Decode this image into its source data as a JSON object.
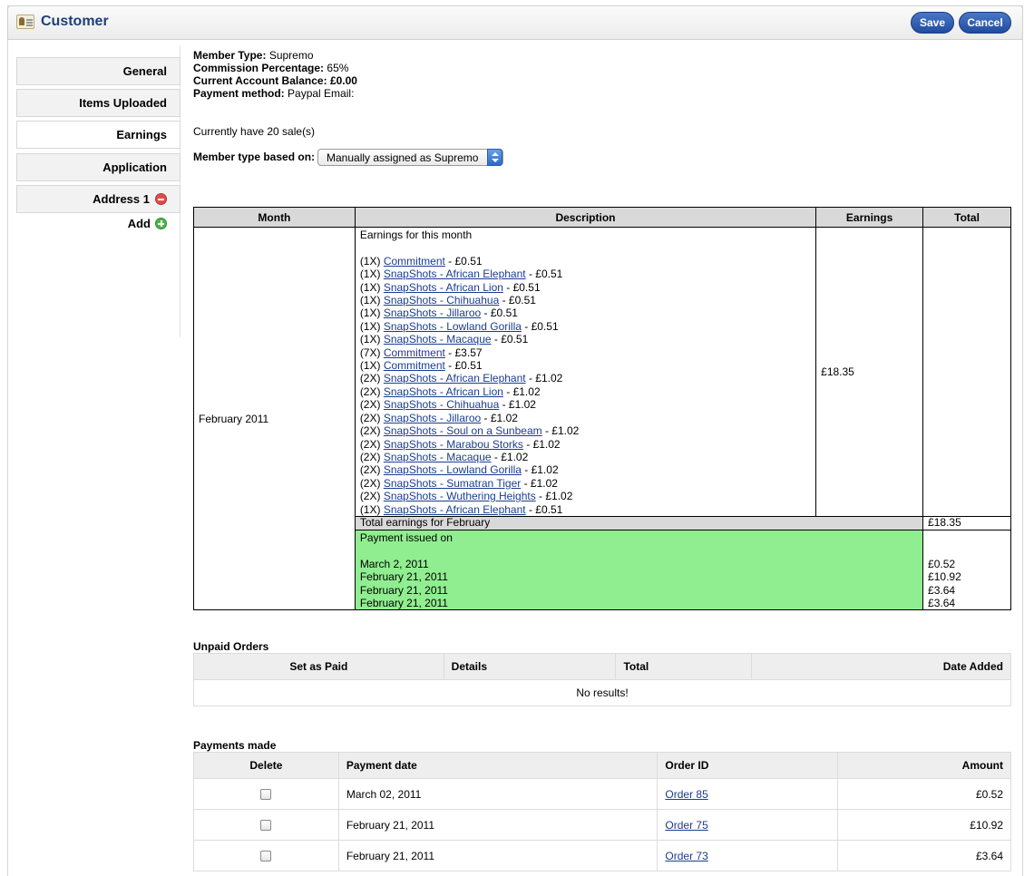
{
  "header": {
    "title": "Customer",
    "save_label": "Save",
    "cancel_label": "Cancel"
  },
  "sidebar": {
    "tabs": [
      {
        "label": "General"
      },
      {
        "label": "Items Uploaded"
      },
      {
        "label": "Earnings"
      },
      {
        "label": "Application"
      },
      {
        "label": "Address 1"
      }
    ],
    "add_label": "Add"
  },
  "info": {
    "member_type_label": "Member Type:",
    "member_type": "Supremo",
    "commission_label": "Commission Percentage:",
    "commission": "65%",
    "balance_label": "Current Account Balance:",
    "balance": "£0.00",
    "payment_method_label": "Payment method:",
    "payment_method": "Paypal Email:",
    "sales_text": "Currently have 20 sale(s)",
    "member_type_based_label": "Member type based on:",
    "member_type_based_value": "Manually assigned as Supremo"
  },
  "earnings": {
    "headers": [
      "Month",
      "Description",
      "Earnings",
      "Total"
    ],
    "month": "February 2011",
    "intro": "Earnings for this month",
    "items": [
      {
        "qty": "(1X)",
        "name": "Commitment",
        "amount": " - £0.51"
      },
      {
        "qty": "(1X)",
        "name": "SnapShots - African Elephant",
        "amount": " - £0.51"
      },
      {
        "qty": "(1X)",
        "name": "SnapShots - African Lion",
        "amount": " - £0.51"
      },
      {
        "qty": "(1X)",
        "name": "SnapShots - Chihuahua",
        "amount": " - £0.51"
      },
      {
        "qty": "(1X)",
        "name": "SnapShots - Jillaroo",
        "amount": " - £0.51"
      },
      {
        "qty": "(1X)",
        "name": "SnapShots - Lowland Gorilla",
        "amount": " - £0.51"
      },
      {
        "qty": "(1X)",
        "name": "SnapShots - Macaque",
        "amount": " - £0.51"
      },
      {
        "qty": "(7X)",
        "name": "Commitment",
        "amount": " - £3.57"
      },
      {
        "qty": "(1X)",
        "name": "Commitment",
        "amount": " - £0.51"
      },
      {
        "qty": "(2X)",
        "name": "SnapShots - African Elephant",
        "amount": " - £1.02"
      },
      {
        "qty": "(2X)",
        "name": "SnapShots - African Lion",
        "amount": " - £1.02"
      },
      {
        "qty": "(2X)",
        "name": "SnapShots - Chihuahua",
        "amount": " - £1.02"
      },
      {
        "qty": "(2X)",
        "name": "SnapShots - Jillaroo",
        "amount": " - £1.02"
      },
      {
        "qty": "(2X)",
        "name": "SnapShots - Soul on a Sunbeam",
        "amount": " - £1.02"
      },
      {
        "qty": "(2X)",
        "name": "SnapShots - Marabou Storks",
        "amount": " - £1.02"
      },
      {
        "qty": "(2X)",
        "name": "SnapShots - Macaque",
        "amount": " - £1.02"
      },
      {
        "qty": "(2X)",
        "name": "SnapShots - Lowland Gorilla",
        "amount": " - £1.02"
      },
      {
        "qty": "(2X)",
        "name": "SnapShots - Sumatran Tiger",
        "amount": " - £1.02"
      },
      {
        "qty": "(2X)",
        "name": "SnapShots - Wuthering Heights",
        "amount": " - £1.02"
      },
      {
        "qty": "(1X)",
        "name": "SnapShots - African Elephant",
        "amount": " - £0.51"
      }
    ],
    "earnings_value": "£18.35",
    "total_label": "Total earnings for February",
    "total_value": "£18.35",
    "payment_issued_label": "Payment issued on",
    "payments": [
      {
        "date": "March 2, 2011",
        "amount": "£0.52"
      },
      {
        "date": "February 21, 2011",
        "amount": "£10.92"
      },
      {
        "date": "February 21, 2011",
        "amount": "£3.64"
      },
      {
        "date": "February 21, 2011",
        "amount": "£3.64"
      }
    ]
  },
  "unpaid": {
    "title": "Unpaid Orders",
    "headers": [
      "Set as Paid",
      "Details",
      "Total",
      "Date Added"
    ],
    "empty": "No results!"
  },
  "payments_made": {
    "title": "Payments made",
    "headers": [
      "Delete",
      "Payment date",
      "Order ID",
      "Amount"
    ],
    "rows": [
      {
        "date": "March 02, 2011",
        "order": "Order 85",
        "amount": "£0.52"
      },
      {
        "date": "February 21, 2011",
        "order": "Order 75",
        "amount": "£10.92"
      },
      {
        "date": "February 21, 2011",
        "order": "Order 73",
        "amount": "£3.64"
      }
    ]
  },
  "colors": {
    "accent": "#1f4c9e",
    "title": "#1d3f7a",
    "payment_bg": "#90ee90",
    "header_bg": "#d9d9d9"
  }
}
